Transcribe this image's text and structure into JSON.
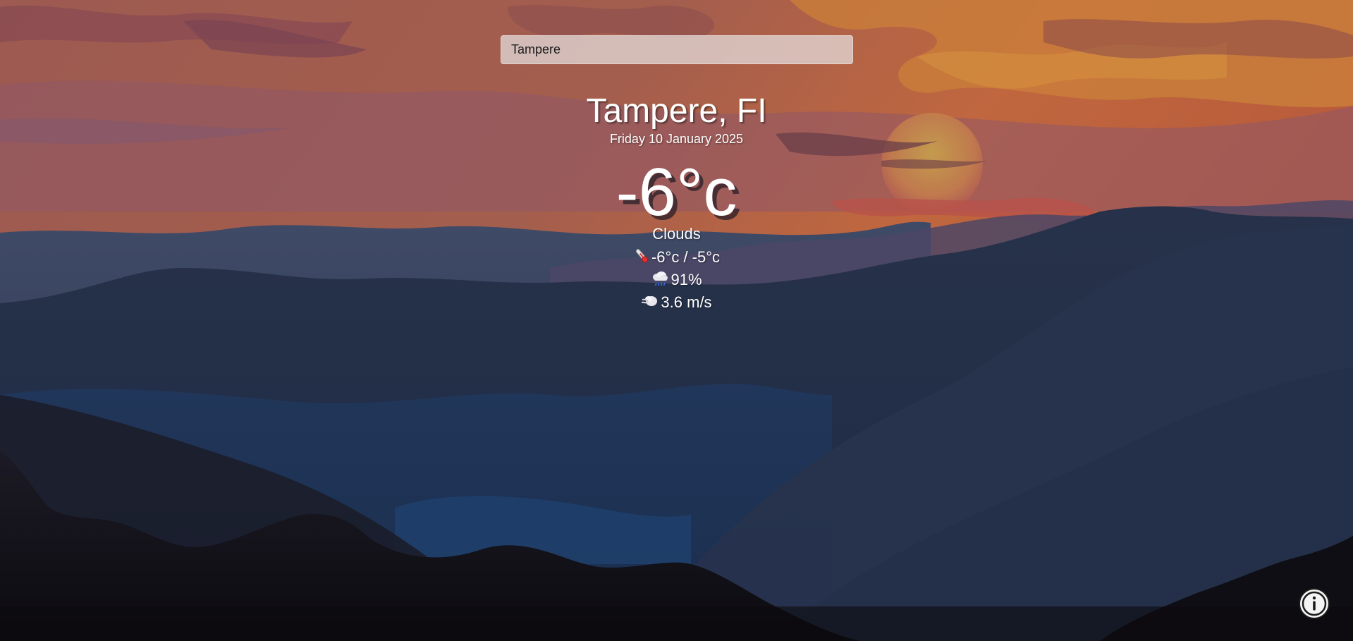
{
  "search": {
    "value": "Tampere",
    "placeholder": ""
  },
  "weather": {
    "location": "Tampere, FI",
    "date": "Friday 10 January 2025",
    "temperature": "-6°c",
    "condition": "Clouds",
    "temp_range": "-6°c / -5°c",
    "humidity": "91%",
    "wind": "3.6 m/s"
  },
  "icons": {
    "temp_range": "thermometer-icon",
    "humidity": "cloud-rain-icon",
    "wind": "wind-face-icon",
    "info": "info-icon"
  },
  "colors": {
    "text": "#ffffff",
    "sky_top": "#a55a4e",
    "sky_orange": "#c86a3a",
    "sun": "#c9a24c",
    "mountain_far": "#3b4560",
    "mountain_mid": "#25324b",
    "mountain_near": "#14121a"
  }
}
